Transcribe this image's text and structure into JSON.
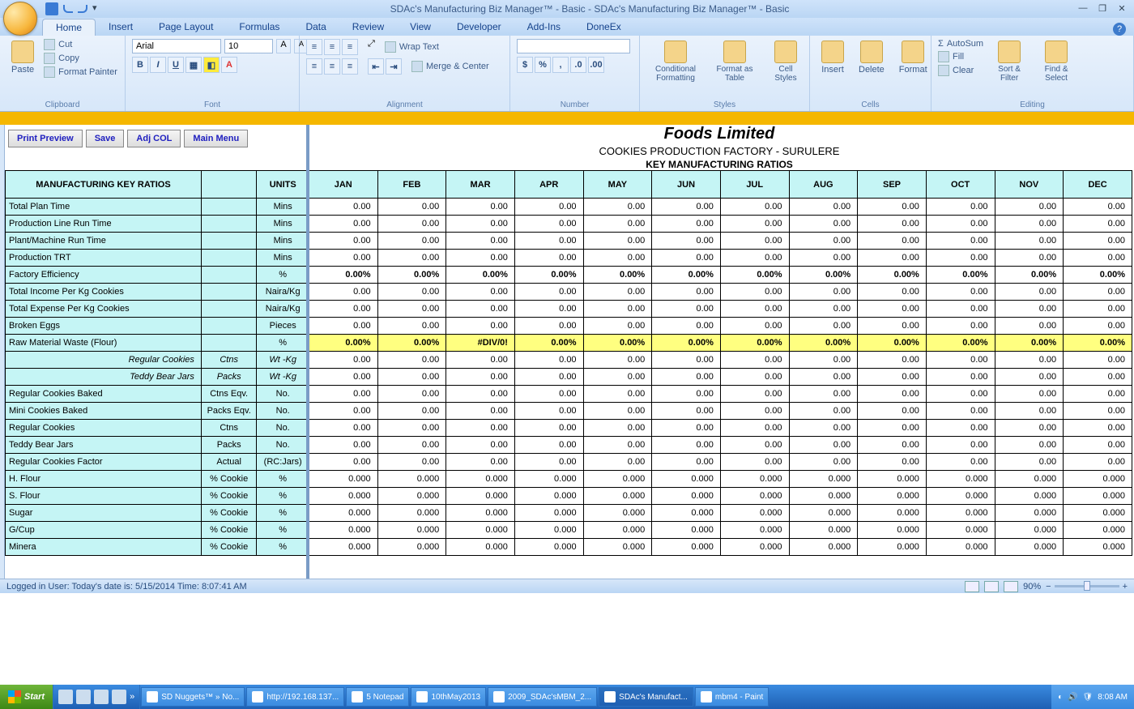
{
  "titlebar": {
    "title": "SDAc's Manufacturing Biz Manager™ - Basic - SDAc's Manufacturing Biz Manager™ - Basic"
  },
  "ribbon": {
    "tabs": [
      "Home",
      "Insert",
      "Page Layout",
      "Formulas",
      "Data",
      "Review",
      "View",
      "Developer",
      "Add-Ins",
      "DoneEx"
    ],
    "active": 0,
    "clipboard": {
      "paste": "Paste",
      "cut": "Cut",
      "copy": "Copy",
      "format_painter": "Format Painter",
      "label": "Clipboard"
    },
    "font": {
      "name": "Arial",
      "size": "10",
      "label": "Font"
    },
    "alignment": {
      "wrap": "Wrap Text",
      "merge": "Merge & Center",
      "label": "Alignment"
    },
    "number": {
      "label": "Number",
      "currency": "$",
      "percent": "%",
      "comma": ","
    },
    "styles": {
      "cond": "Conditional Formatting",
      "fmt": "Format as Table",
      "cell": "Cell Styles",
      "label": "Styles"
    },
    "cells": {
      "insert": "Insert",
      "delete": "Delete",
      "format": "Format",
      "label": "Cells"
    },
    "editing": {
      "autosum": "AutoSum",
      "fill": "Fill",
      "clear": "Clear",
      "sort": "Sort & Filter",
      "find": "Find & Select",
      "label": "Editing"
    }
  },
  "macros": {
    "preview": "Print Preview",
    "save": "Save",
    "adj": "Adj COL",
    "main": "Main Menu"
  },
  "report": {
    "title1": "Foods Limited",
    "title2": "COOKIES PRODUCTION FACTORY - SURULERE",
    "title3": "KEY MANUFACTURING RATIOS",
    "header_ratio": "MANUFACTURING KEY RATIOS",
    "header_units": "UNITS",
    "months": [
      "JAN",
      "FEB",
      "MAR",
      "APR",
      "MAY",
      "JUN",
      "JUL",
      "AUG",
      "SEP",
      "OCT",
      "NOV",
      "DEC"
    ]
  },
  "rows": [
    {
      "label": "Total Plan Time",
      "unit1": "",
      "unit2": "Mins",
      "vals": [
        "0.00",
        "0.00",
        "0.00",
        "0.00",
        "0.00",
        "0.00",
        "0.00",
        "0.00",
        "0.00",
        "0.00",
        "0.00",
        "0.00"
      ]
    },
    {
      "label": "Production Line Run Time",
      "unit1": "",
      "unit2": "Mins",
      "vals": [
        "0.00",
        "0.00",
        "0.00",
        "0.00",
        "0.00",
        "0.00",
        "0.00",
        "0.00",
        "0.00",
        "0.00",
        "0.00",
        "0.00"
      ]
    },
    {
      "label": "Plant/Machine Run Time",
      "unit1": "",
      "unit2": "Mins",
      "vals": [
        "0.00",
        "0.00",
        "0.00",
        "0.00",
        "0.00",
        "0.00",
        "0.00",
        "0.00",
        "0.00",
        "0.00",
        "0.00",
        "0.00"
      ]
    },
    {
      "label": "Production TRT",
      "unit1": "",
      "unit2": "Mins",
      "vals": [
        "0.00",
        "0.00",
        "0.00",
        "0.00",
        "0.00",
        "0.00",
        "0.00",
        "0.00",
        "0.00",
        "0.00",
        "0.00",
        "0.00"
      ]
    },
    {
      "label": "Factory Efficiency",
      "unit1": "",
      "unit2": "%",
      "vals": [
        "0.00%",
        "0.00%",
        "0.00%",
        "0.00%",
        "0.00%",
        "0.00%",
        "0.00%",
        "0.00%",
        "0.00%",
        "0.00%",
        "0.00%",
        "0.00%"
      ],
      "style": "bold"
    },
    {
      "label": "Total Income Per Kg Cookies",
      "unit1": "",
      "unit2": "Naira/Kg",
      "vals": [
        "0.00",
        "0.00",
        "0.00",
        "0.00",
        "0.00",
        "0.00",
        "0.00",
        "0.00",
        "0.00",
        "0.00",
        "0.00",
        "0.00"
      ]
    },
    {
      "label": "Total Expense Per Kg Cookies",
      "unit1": "",
      "unit2": "Naira/Kg",
      "vals": [
        "0.00",
        "0.00",
        "0.00",
        "0.00",
        "0.00",
        "0.00",
        "0.00",
        "0.00",
        "0.00",
        "0.00",
        "0.00",
        "0.00"
      ]
    },
    {
      "label": "Broken Eggs",
      "unit1": "",
      "unit2": "Pieces",
      "vals": [
        "0.00",
        "0.00",
        "0.00",
        "0.00",
        "0.00",
        "0.00",
        "0.00",
        "0.00",
        "0.00",
        "0.00",
        "0.00",
        "0.00"
      ]
    },
    {
      "label": "Raw Material Waste (Flour)",
      "unit1": "",
      "unit2": "%",
      "vals": [
        "0.00%",
        "0.00%",
        "#DIV/0!",
        "0.00%",
        "0.00%",
        "0.00%",
        "0.00%",
        "0.00%",
        "0.00%",
        "0.00%",
        "0.00%",
        "0.00%"
      ],
      "style": "yel"
    },
    {
      "label": "Regular Cookies",
      "unit1": "Ctns",
      "unit2": "Wt -Kg",
      "vals": [
        "0.00",
        "0.00",
        "0.00",
        "0.00",
        "0.00",
        "0.00",
        "0.00",
        "0.00",
        "0.00",
        "0.00",
        "0.00",
        "0.00"
      ],
      "ital": true
    },
    {
      "label": "Teddy Bear Jars",
      "unit1": "Packs",
      "unit2": "Wt -Kg",
      "vals": [
        "0.00",
        "0.00",
        "0.00",
        "0.00",
        "0.00",
        "0.00",
        "0.00",
        "0.00",
        "0.00",
        "0.00",
        "0.00",
        "0.00"
      ],
      "ital": true
    },
    {
      "label": "Regular Cookies Baked",
      "unit1": "Ctns Eqv.",
      "unit2": "No.",
      "vals": [
        "0.00",
        "0.00",
        "0.00",
        "0.00",
        "0.00",
        "0.00",
        "0.00",
        "0.00",
        "0.00",
        "0.00",
        "0.00",
        "0.00"
      ]
    },
    {
      "label": "Mini Cookies Baked",
      "unit1": "Packs Eqv.",
      "unit2": "No.",
      "vals": [
        "0.00",
        "0.00",
        "0.00",
        "0.00",
        "0.00",
        "0.00",
        "0.00",
        "0.00",
        "0.00",
        "0.00",
        "0.00",
        "0.00"
      ]
    },
    {
      "label": "Regular Cookies",
      "unit1": "Ctns",
      "unit2": "No.",
      "vals": [
        "0.00",
        "0.00",
        "0.00",
        "0.00",
        "0.00",
        "0.00",
        "0.00",
        "0.00",
        "0.00",
        "0.00",
        "0.00",
        "0.00"
      ]
    },
    {
      "label": "Teddy Bear Jars",
      "unit1": "Packs",
      "unit2": "No.",
      "vals": [
        "0.00",
        "0.00",
        "0.00",
        "0.00",
        "0.00",
        "0.00",
        "0.00",
        "0.00",
        "0.00",
        "0.00",
        "0.00",
        "0.00"
      ]
    },
    {
      "label": "Regular Cookies Factor",
      "unit1": "Actual",
      "unit2": "(RC:Jars)",
      "vals": [
        "0.00",
        "0.00",
        "0.00",
        "0.00",
        "0.00",
        "0.00",
        "0.00",
        "0.00",
        "0.00",
        "0.00",
        "0.00",
        "0.00"
      ]
    },
    {
      "label": "H. Flour",
      "unit1": "% Cookie",
      "unit2": "%",
      "vals": [
        "0.000",
        "0.000",
        "0.000",
        "0.000",
        "0.000",
        "0.000",
        "0.000",
        "0.000",
        "0.000",
        "0.000",
        "0.000",
        "0.000"
      ]
    },
    {
      "label": "S. Flour",
      "unit1": "% Cookie",
      "unit2": "%",
      "vals": [
        "0.000",
        "0.000",
        "0.000",
        "0.000",
        "0.000",
        "0.000",
        "0.000",
        "0.000",
        "0.000",
        "0.000",
        "0.000",
        "0.000"
      ]
    },
    {
      "label": "Sugar",
      "unit1": "% Cookie",
      "unit2": "%",
      "vals": [
        "0.000",
        "0.000",
        "0.000",
        "0.000",
        "0.000",
        "0.000",
        "0.000",
        "0.000",
        "0.000",
        "0.000",
        "0.000",
        "0.000"
      ]
    },
    {
      "label": "G/Cup",
      "unit1": "% Cookie",
      "unit2": "%",
      "vals": [
        "0.000",
        "0.000",
        "0.000",
        "0.000",
        "0.000",
        "0.000",
        "0.000",
        "0.000",
        "0.000",
        "0.000",
        "0.000",
        "0.000"
      ]
    },
    {
      "label": "Minera",
      "unit1": "% Cookie",
      "unit2": "%",
      "vals": [
        "0.000",
        "0.000",
        "0.000",
        "0.000",
        "0.000",
        "0.000",
        "0.000",
        "0.000",
        "0.000",
        "0.000",
        "0.000",
        "0.000"
      ]
    }
  ],
  "status": {
    "text": "Logged in User:  Today's date is: 5/15/2014 Time: 8:07:41 AM",
    "zoom": "90%"
  },
  "taskbar": {
    "start": "Start",
    "items": [
      "SD Nuggets™ » No...",
      "http://192.168.137...",
      "5 Notepad",
      "10thMay2013",
      "2009_SDAc'sMBM_2...",
      "SDAc's Manufact...",
      "mbm4 - Paint"
    ],
    "active_index": 5,
    "time": "8:08 AM"
  }
}
